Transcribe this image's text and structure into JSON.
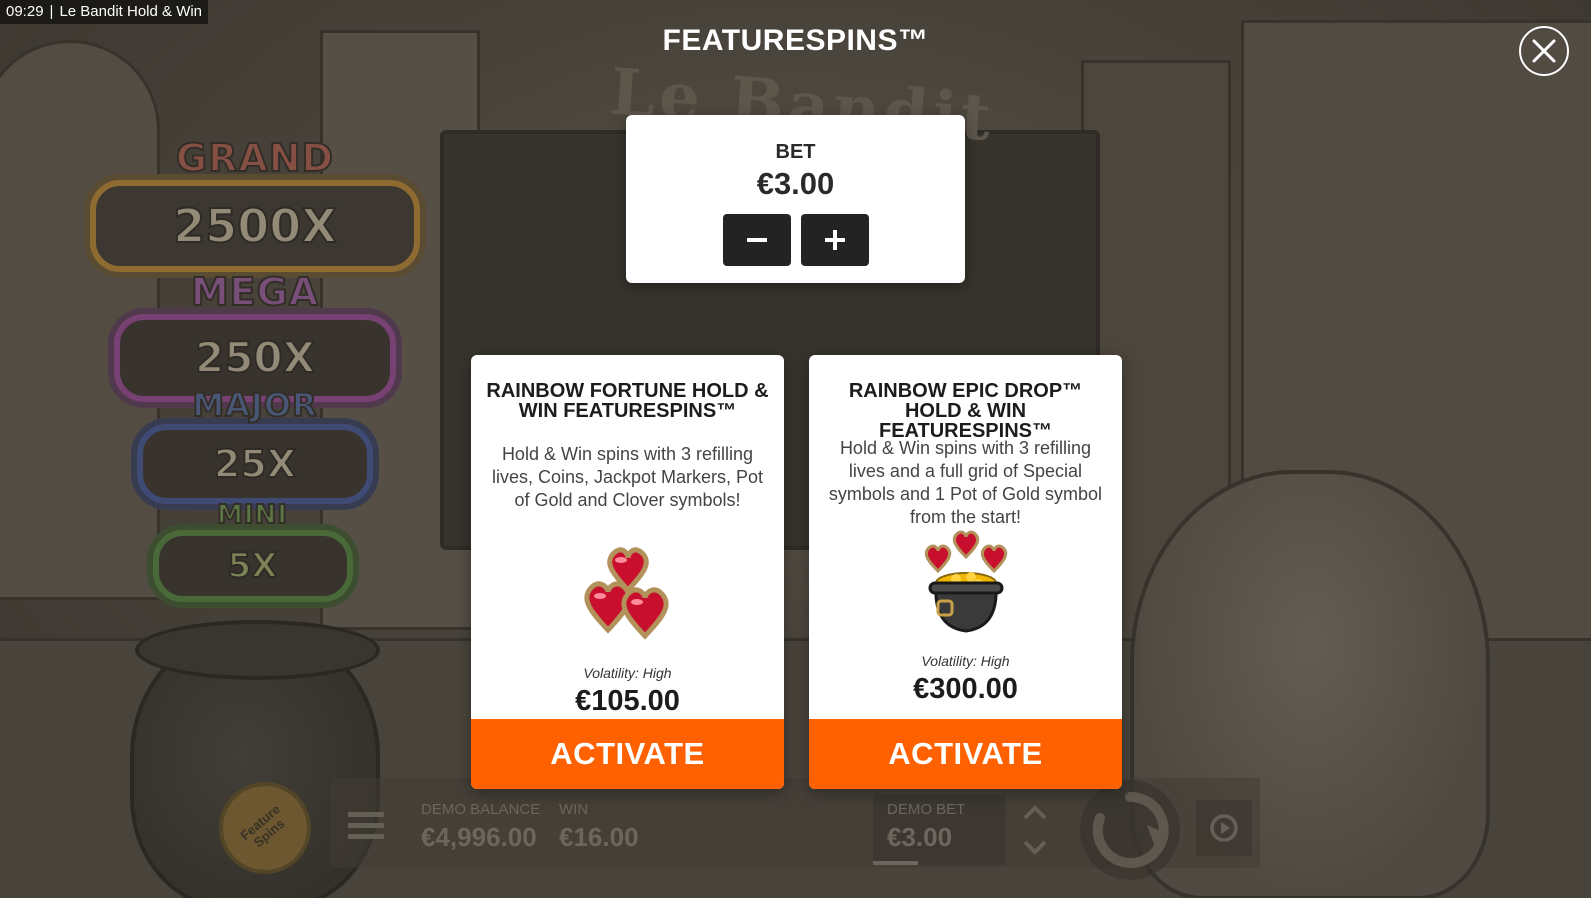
{
  "status_bar": {
    "time": "09:29",
    "separator": "|",
    "window_title": "Le Bandit Hold & Win"
  },
  "modal": {
    "title": "FEATURESPINS™",
    "close_icon": "close-icon"
  },
  "bet_panel": {
    "label": "BET",
    "value": "€3.00",
    "decrease_icon": "minus-icon",
    "increase_icon": "plus-icon"
  },
  "cards": [
    {
      "title": "RAINBOW FORTUNE HOLD & WIN FEATURESPINS™",
      "description": "Hold & Win spins with 3 refilling lives, Coins, Jackpot Markers, Pot of Gold and Clover symbols!",
      "art_icon": "three-hearts-icon",
      "volatility": "Volatility: High",
      "price": "€105.00",
      "button": "ACTIVATE"
    },
    {
      "title": "RAINBOW EPIC DROP™ HOLD & WIN FEATURESPINS™",
      "description": "Hold & Win spins with 3 refilling lives and a full grid of Special symbols and 1 Pot of Gold symbol from the start!",
      "art_icon": "pot-of-gold-hearts-icon",
      "volatility": "Volatility: High",
      "price": "€300.00",
      "button": "ACTIVATE"
    }
  ],
  "background": {
    "game_logo": "Le Bandit",
    "jackpots": [
      {
        "name": "GRAND",
        "value": "2500X"
      },
      {
        "name": "MEGA",
        "value": "250X"
      },
      {
        "name": "MAJOR",
        "value": "25X"
      },
      {
        "name": "MINI",
        "value": "5X"
      }
    ],
    "feature_badge": "Feature Spins",
    "demo_balance_label": "DEMO BALANCE",
    "demo_balance_value": "€4,996.00",
    "win_label": "WIN",
    "win_value": "€16.00",
    "demo_bet_label": "DEMO BET",
    "demo_bet_value": "€3.00"
  },
  "colors": {
    "accent": "#ff6100",
    "button_dark": "#232323",
    "card_bg": "#ffffff"
  }
}
